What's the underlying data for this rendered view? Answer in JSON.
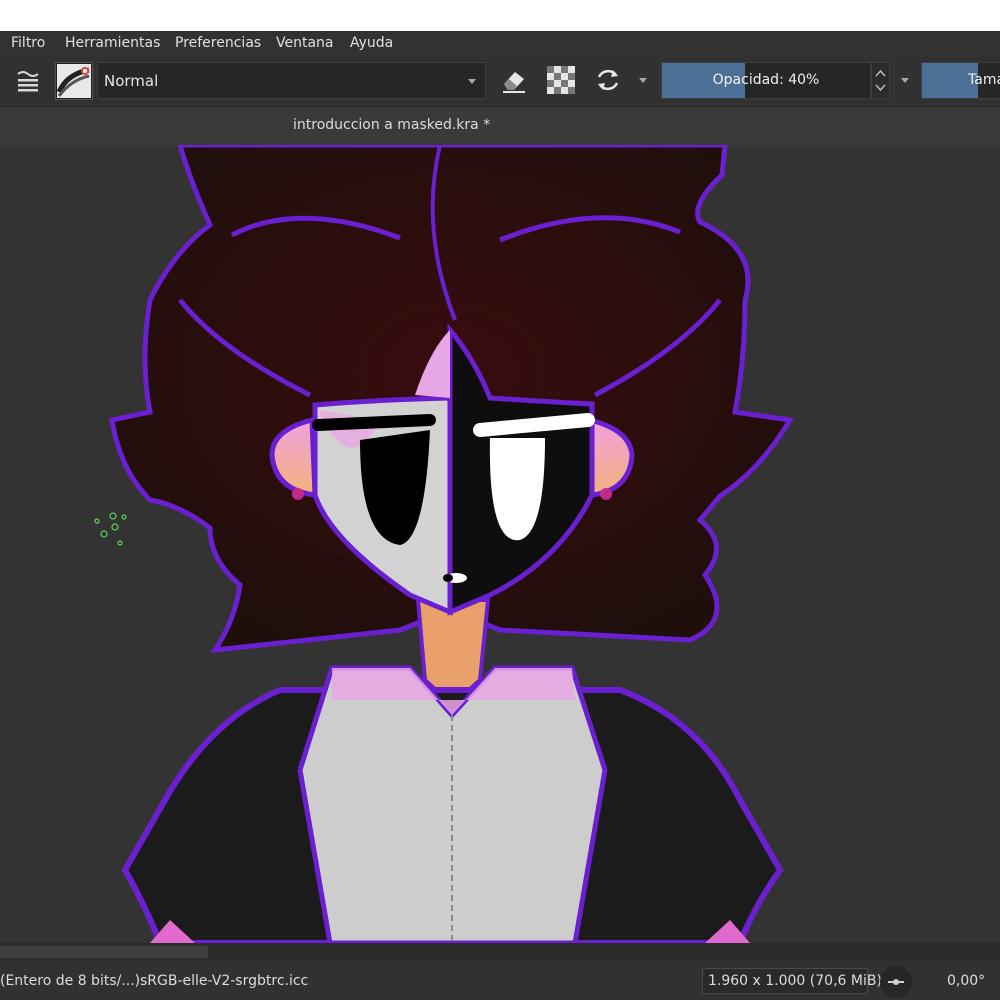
{
  "menubar": {
    "items": [
      {
        "label": "Filtro"
      },
      {
        "label": "Herramientas"
      },
      {
        "label": "Preferencias"
      },
      {
        "label": "Ventana"
      },
      {
        "label": "Ayuda"
      }
    ]
  },
  "toolbar": {
    "blend_mode": "Normal",
    "opacity": {
      "label": "Opacidad: 40%",
      "value_percent": 40
    },
    "size": {
      "label": "Tama",
      "value_fraction": 0.72
    },
    "icons": [
      "brush-settings-icon",
      "brush-preset-icon",
      "eraser-icon",
      "alpha-lock-icon",
      "reload-preset-icon"
    ]
  },
  "document": {
    "tab_title": "introduccion a masked.kra *"
  },
  "statusbar": {
    "color_model": "(Entero de 8 bits/...)",
    "color_profile": "sRGB-elle-V2-srgbtrc.icc",
    "image_size": "1.960 x 1.000 (70,6 MiB)",
    "rotation": "0,00°"
  },
  "colors": {
    "accent": "#4b6f95",
    "outline": "#6a1fd0",
    "hair": "#22100c",
    "skin_pink": "#e4a2e0"
  }
}
